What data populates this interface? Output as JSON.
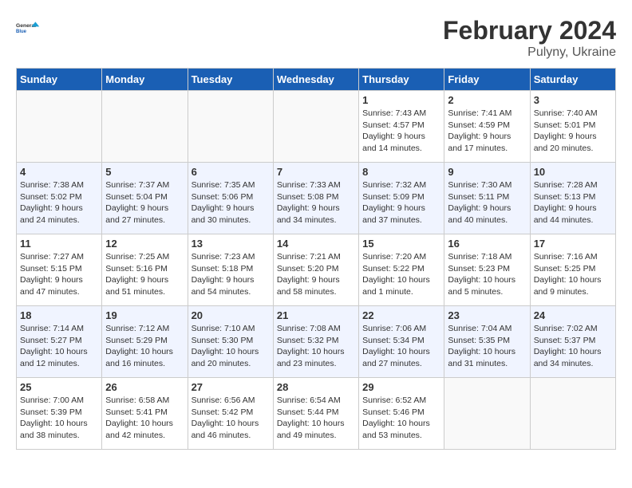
{
  "header": {
    "logo_line1": "General",
    "logo_line2": "Blue",
    "month": "February 2024",
    "location": "Pulyny, Ukraine"
  },
  "weekdays": [
    "Sunday",
    "Monday",
    "Tuesday",
    "Wednesday",
    "Thursday",
    "Friday",
    "Saturday"
  ],
  "weeks": [
    [
      {
        "day": "",
        "sunrise": "",
        "sunset": "",
        "daylight": "",
        "empty": true
      },
      {
        "day": "",
        "sunrise": "",
        "sunset": "",
        "daylight": "",
        "empty": true
      },
      {
        "day": "",
        "sunrise": "",
        "sunset": "",
        "daylight": "",
        "empty": true
      },
      {
        "day": "",
        "sunrise": "",
        "sunset": "",
        "daylight": "",
        "empty": true
      },
      {
        "day": "1",
        "sunrise": "Sunrise: 7:43 AM",
        "sunset": "Sunset: 4:57 PM",
        "daylight": "Daylight: 9 hours and 14 minutes.",
        "empty": false
      },
      {
        "day": "2",
        "sunrise": "Sunrise: 7:41 AM",
        "sunset": "Sunset: 4:59 PM",
        "daylight": "Daylight: 9 hours and 17 minutes.",
        "empty": false
      },
      {
        "day": "3",
        "sunrise": "Sunrise: 7:40 AM",
        "sunset": "Sunset: 5:01 PM",
        "daylight": "Daylight: 9 hours and 20 minutes.",
        "empty": false
      }
    ],
    [
      {
        "day": "4",
        "sunrise": "Sunrise: 7:38 AM",
        "sunset": "Sunset: 5:02 PM",
        "daylight": "Daylight: 9 hours and 24 minutes.",
        "empty": false
      },
      {
        "day": "5",
        "sunrise": "Sunrise: 7:37 AM",
        "sunset": "Sunset: 5:04 PM",
        "daylight": "Daylight: 9 hours and 27 minutes.",
        "empty": false
      },
      {
        "day": "6",
        "sunrise": "Sunrise: 7:35 AM",
        "sunset": "Sunset: 5:06 PM",
        "daylight": "Daylight: 9 hours and 30 minutes.",
        "empty": false
      },
      {
        "day": "7",
        "sunrise": "Sunrise: 7:33 AM",
        "sunset": "Sunset: 5:08 PM",
        "daylight": "Daylight: 9 hours and 34 minutes.",
        "empty": false
      },
      {
        "day": "8",
        "sunrise": "Sunrise: 7:32 AM",
        "sunset": "Sunset: 5:09 PM",
        "daylight": "Daylight: 9 hours and 37 minutes.",
        "empty": false
      },
      {
        "day": "9",
        "sunrise": "Sunrise: 7:30 AM",
        "sunset": "Sunset: 5:11 PM",
        "daylight": "Daylight: 9 hours and 40 minutes.",
        "empty": false
      },
      {
        "day": "10",
        "sunrise": "Sunrise: 7:28 AM",
        "sunset": "Sunset: 5:13 PM",
        "daylight": "Daylight: 9 hours and 44 minutes.",
        "empty": false
      }
    ],
    [
      {
        "day": "11",
        "sunrise": "Sunrise: 7:27 AM",
        "sunset": "Sunset: 5:15 PM",
        "daylight": "Daylight: 9 hours and 47 minutes.",
        "empty": false
      },
      {
        "day": "12",
        "sunrise": "Sunrise: 7:25 AM",
        "sunset": "Sunset: 5:16 PM",
        "daylight": "Daylight: 9 hours and 51 minutes.",
        "empty": false
      },
      {
        "day": "13",
        "sunrise": "Sunrise: 7:23 AM",
        "sunset": "Sunset: 5:18 PM",
        "daylight": "Daylight: 9 hours and 54 minutes.",
        "empty": false
      },
      {
        "day": "14",
        "sunrise": "Sunrise: 7:21 AM",
        "sunset": "Sunset: 5:20 PM",
        "daylight": "Daylight: 9 hours and 58 minutes.",
        "empty": false
      },
      {
        "day": "15",
        "sunrise": "Sunrise: 7:20 AM",
        "sunset": "Sunset: 5:22 PM",
        "daylight": "Daylight: 10 hours and 1 minute.",
        "empty": false
      },
      {
        "day": "16",
        "sunrise": "Sunrise: 7:18 AM",
        "sunset": "Sunset: 5:23 PM",
        "daylight": "Daylight: 10 hours and 5 minutes.",
        "empty": false
      },
      {
        "day": "17",
        "sunrise": "Sunrise: 7:16 AM",
        "sunset": "Sunset: 5:25 PM",
        "daylight": "Daylight: 10 hours and 9 minutes.",
        "empty": false
      }
    ],
    [
      {
        "day": "18",
        "sunrise": "Sunrise: 7:14 AM",
        "sunset": "Sunset: 5:27 PM",
        "daylight": "Daylight: 10 hours and 12 minutes.",
        "empty": false
      },
      {
        "day": "19",
        "sunrise": "Sunrise: 7:12 AM",
        "sunset": "Sunset: 5:29 PM",
        "daylight": "Daylight: 10 hours and 16 minutes.",
        "empty": false
      },
      {
        "day": "20",
        "sunrise": "Sunrise: 7:10 AM",
        "sunset": "Sunset: 5:30 PM",
        "daylight": "Daylight: 10 hours and 20 minutes.",
        "empty": false
      },
      {
        "day": "21",
        "sunrise": "Sunrise: 7:08 AM",
        "sunset": "Sunset: 5:32 PM",
        "daylight": "Daylight: 10 hours and 23 minutes.",
        "empty": false
      },
      {
        "day": "22",
        "sunrise": "Sunrise: 7:06 AM",
        "sunset": "Sunset: 5:34 PM",
        "daylight": "Daylight: 10 hours and 27 minutes.",
        "empty": false
      },
      {
        "day": "23",
        "sunrise": "Sunrise: 7:04 AM",
        "sunset": "Sunset: 5:35 PM",
        "daylight": "Daylight: 10 hours and 31 minutes.",
        "empty": false
      },
      {
        "day": "24",
        "sunrise": "Sunrise: 7:02 AM",
        "sunset": "Sunset: 5:37 PM",
        "daylight": "Daylight: 10 hours and 34 minutes.",
        "empty": false
      }
    ],
    [
      {
        "day": "25",
        "sunrise": "Sunrise: 7:00 AM",
        "sunset": "Sunset: 5:39 PM",
        "daylight": "Daylight: 10 hours and 38 minutes.",
        "empty": false
      },
      {
        "day": "26",
        "sunrise": "Sunrise: 6:58 AM",
        "sunset": "Sunset: 5:41 PM",
        "daylight": "Daylight: 10 hours and 42 minutes.",
        "empty": false
      },
      {
        "day": "27",
        "sunrise": "Sunrise: 6:56 AM",
        "sunset": "Sunset: 5:42 PM",
        "daylight": "Daylight: 10 hours and 46 minutes.",
        "empty": false
      },
      {
        "day": "28",
        "sunrise": "Sunrise: 6:54 AM",
        "sunset": "Sunset: 5:44 PM",
        "daylight": "Daylight: 10 hours and 49 minutes.",
        "empty": false
      },
      {
        "day": "29",
        "sunrise": "Sunrise: 6:52 AM",
        "sunset": "Sunset: 5:46 PM",
        "daylight": "Daylight: 10 hours and 53 minutes.",
        "empty": false
      },
      {
        "day": "",
        "sunrise": "",
        "sunset": "",
        "daylight": "",
        "empty": true
      },
      {
        "day": "",
        "sunrise": "",
        "sunset": "",
        "daylight": "",
        "empty": true
      }
    ]
  ]
}
